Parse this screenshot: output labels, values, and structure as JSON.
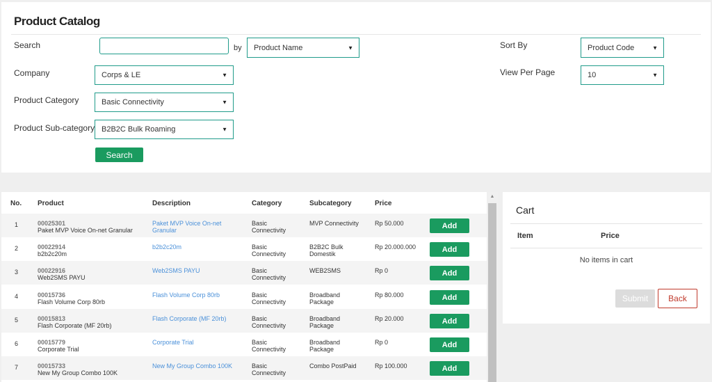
{
  "header": {
    "title": "Product Catalog"
  },
  "filters": {
    "search_label": "Search",
    "search_value": "",
    "by_label": "by",
    "by_value": "Product Name",
    "company_label": "Company",
    "company_value": "Corps & LE",
    "category_label": "Product Category",
    "category_value": "Basic Connectivity",
    "subcategory_label": "Product Sub-category",
    "subcategory_value": "B2B2C Bulk Roaming",
    "sort_label": "Sort By",
    "sort_value": "Product Code",
    "perpage_label": "View Per Page",
    "perpage_value": "10",
    "search_button": "Search"
  },
  "table": {
    "columns": [
      "No.",
      "Product",
      "Description",
      "Category",
      "Subcategory",
      "Price"
    ],
    "add_label": "Add",
    "rows": [
      {
        "no": "1",
        "code": "00025301",
        "name": "Paket MVP Voice On-net Granular",
        "description": "Paket MVP Voice On-net Granular",
        "category": "Basic Connectivity",
        "subcategory": "MVP Connectivity",
        "price": "Rp 50.000"
      },
      {
        "no": "2",
        "code": "00022914",
        "name": "b2b2c20m",
        "description": "b2b2c20m",
        "category": "Basic Connectivity",
        "subcategory": "B2B2C Bulk Domestik",
        "price": "Rp 20.000.000"
      },
      {
        "no": "3",
        "code": "00022916",
        "name": "Web2SMS PAYU",
        "description": "Web2SMS PAYU",
        "category": "Basic Connectivity",
        "subcategory": "WEB2SMS",
        "price": "Rp 0"
      },
      {
        "no": "4",
        "code": "00015736",
        "name": "Flash Volume Corp 80rb",
        "description": "Flash Volume Corp 80rb",
        "category": "Basic Connectivity",
        "subcategory": "Broadband Package",
        "price": "Rp 80.000"
      },
      {
        "no": "5",
        "code": "00015813",
        "name": "Flash Corporate (MF 20rb)",
        "description": "Flash Corporate (MF 20rb)",
        "category": "Basic Connectivity",
        "subcategory": "Broadband Package",
        "price": "Rp 20.000"
      },
      {
        "no": "6",
        "code": "00015779",
        "name": "Corporate Trial",
        "description": "Corporate Trial",
        "category": "Basic Connectivity",
        "subcategory": "Broadband Package",
        "price": "Rp 0"
      },
      {
        "no": "7",
        "code": "00015733",
        "name": "New My Group Combo 100K",
        "description": "New My Group Combo 100K",
        "category": "Basic Connectivity",
        "subcategory": "Combo PostPaid",
        "price": "Rp 100.000"
      }
    ]
  },
  "cart": {
    "title": "Cart",
    "item_header": "Item",
    "price_header": "Price",
    "empty_text": "No items in cart",
    "submit_label": "Submit",
    "back_label": "Back"
  },
  "icons": {
    "dropdown": "caret-down-icon",
    "scroll": "scroll-up-arrow-icon"
  },
  "colors": {
    "accent": "#1a9b5f",
    "border": "#1f9b8a",
    "link": "#4a90d9",
    "danger": "#c0392b"
  }
}
